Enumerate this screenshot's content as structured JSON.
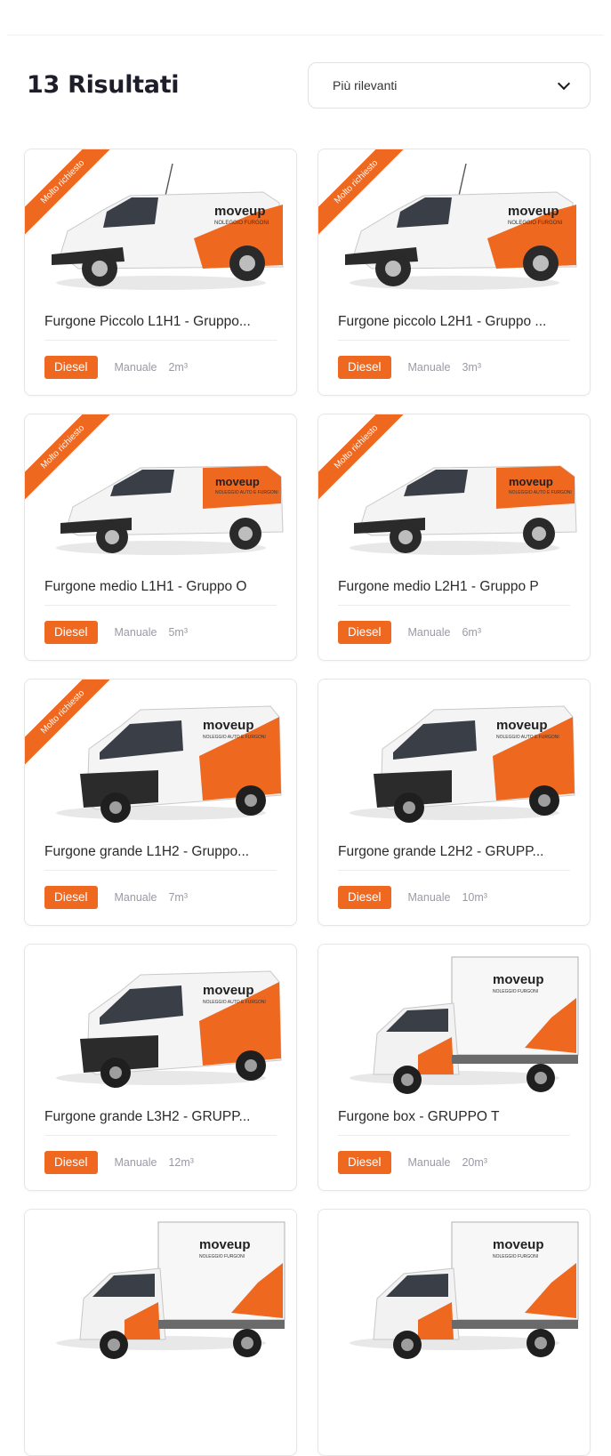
{
  "header": {
    "results_title": "13 Risultati"
  },
  "sort": {
    "selected": "Più rilevanti"
  },
  "colors": {
    "accent": "#ef6820",
    "text": "#2a2a2a",
    "muted": "#9a9aa6"
  },
  "vans": [
    {
      "title": "Furgone Piccolo L1H1 - Gruppo...",
      "ribbon": "Molto richiesto",
      "fuel": "Diesel",
      "transmission": "Manuale",
      "volume": "2m³",
      "kind": "small"
    },
    {
      "title": "Furgone piccolo L2H1 - Gruppo ...",
      "ribbon": "Molto richiesto",
      "fuel": "Diesel",
      "transmission": "Manuale",
      "volume": "3m³",
      "kind": "small"
    },
    {
      "title": "Furgone medio L1H1 - Gruppo O",
      "ribbon": "Molto richiesto",
      "fuel": "Diesel",
      "transmission": "Manuale",
      "volume": "5m³",
      "kind": "medium"
    },
    {
      "title": "Furgone medio L2H1 - Gruppo P",
      "ribbon": "Molto richiesto",
      "fuel": "Diesel",
      "transmission": "Manuale",
      "volume": "6m³",
      "kind": "medium"
    },
    {
      "title": "Furgone grande L1H2 - Gruppo...",
      "ribbon": "Molto richiesto",
      "fuel": "Diesel",
      "transmission": "Manuale",
      "volume": "7m³",
      "kind": "large"
    },
    {
      "title": "Furgone grande L2H2 - GRUPP...",
      "ribbon": "",
      "fuel": "Diesel",
      "transmission": "Manuale",
      "volume": "10m³",
      "kind": "large"
    },
    {
      "title": "Furgone grande L3H2 - GRUPP...",
      "ribbon": "",
      "fuel": "Diesel",
      "transmission": "Manuale",
      "volume": "12m³",
      "kind": "large"
    },
    {
      "title": "Furgone box - GRUPPO T",
      "ribbon": "",
      "fuel": "Diesel",
      "transmission": "Manuale",
      "volume": "20m³",
      "kind": "box"
    },
    {
      "title": "",
      "ribbon": "",
      "fuel": "",
      "transmission": "",
      "volume": "",
      "kind": "box"
    },
    {
      "title": "",
      "ribbon": "",
      "fuel": "",
      "transmission": "",
      "volume": "",
      "kind": "box"
    }
  ],
  "livery": {
    "brand": "moveup",
    "tagline_small": "NOLEGGIO FURGONI",
    "tagline_large": "NOLEGGIO AUTO E FURGONI"
  }
}
